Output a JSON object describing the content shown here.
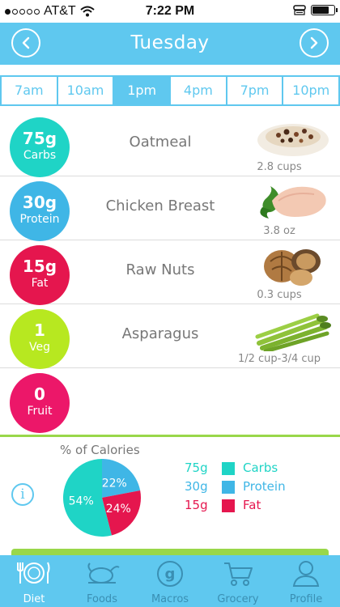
{
  "status_bar": {
    "carrier": "AT&T",
    "time": "7:22 PM",
    "signal_bars": 1,
    "battery_level": 0.85
  },
  "header": {
    "title": "Tuesday",
    "prev_icon": "chevron-left-icon",
    "next_icon": "chevron-right-icon"
  },
  "time_tabs": [
    {
      "label": "7am",
      "active": false
    },
    {
      "label": "10am",
      "active": false
    },
    {
      "label": "1pm",
      "active": true
    },
    {
      "label": "4pm",
      "active": false
    },
    {
      "label": "7pm",
      "active": false
    },
    {
      "label": "10pm",
      "active": false
    }
  ],
  "foods": [
    {
      "amount": "75g",
      "macro": "Carbs",
      "color": "#1fd4c6",
      "name": "Oatmeal",
      "qty": "2.8 cups",
      "image": "oatmeal"
    },
    {
      "amount": "30g",
      "macro": "Protein",
      "color": "#3fb6e6",
      "name": "Chicken Breast",
      "qty": "3.8 oz",
      "image": "chicken"
    },
    {
      "amount": "15g",
      "macro": "Fat",
      "color": "#e5164e",
      "name": "Raw Nuts",
      "qty": "0.3 cups",
      "image": "nuts"
    },
    {
      "amount": "1",
      "macro": "Veg",
      "color": "#b7e820",
      "name": "Asparagus",
      "qty": "1/2 cup-3/4 cup",
      "image": "asparagus"
    },
    {
      "amount": "0",
      "macro": "Fruit",
      "color": "#ec1769",
      "name": "",
      "qty": "",
      "image": ""
    }
  ],
  "calories": {
    "title": "% of Calories",
    "info_icon": "info-icon",
    "chart_data": {
      "type": "pie",
      "categories": [
        "Carbs",
        "Protein",
        "Fat"
      ],
      "values": [
        54,
        22,
        24
      ],
      "labels": [
        "54%",
        "22%",
        "24%"
      ],
      "colors": [
        "#1fd4c6",
        "#3fb6e6",
        "#e5164e"
      ]
    },
    "legend": [
      {
        "value": "75g",
        "name": "Carbs",
        "color": "#1fd4c6"
      },
      {
        "value": "30g",
        "name": "Protein",
        "color": "#3fb6e6"
      },
      {
        "value": "15g",
        "name": "Fat",
        "color": "#e5164e"
      }
    ]
  },
  "tabbar": [
    {
      "label": "Diet",
      "icon": "plate-icon",
      "active": true
    },
    {
      "label": "Foods",
      "icon": "turkey-icon",
      "active": false
    },
    {
      "label": "Macros",
      "icon": "grams-icon",
      "active": false
    },
    {
      "label": "Grocery",
      "icon": "cart-icon",
      "active": false
    },
    {
      "label": "Profile",
      "icon": "person-icon",
      "active": false
    }
  ],
  "colors": {
    "accent": "#5fc8ef",
    "green": "#99d74a"
  }
}
